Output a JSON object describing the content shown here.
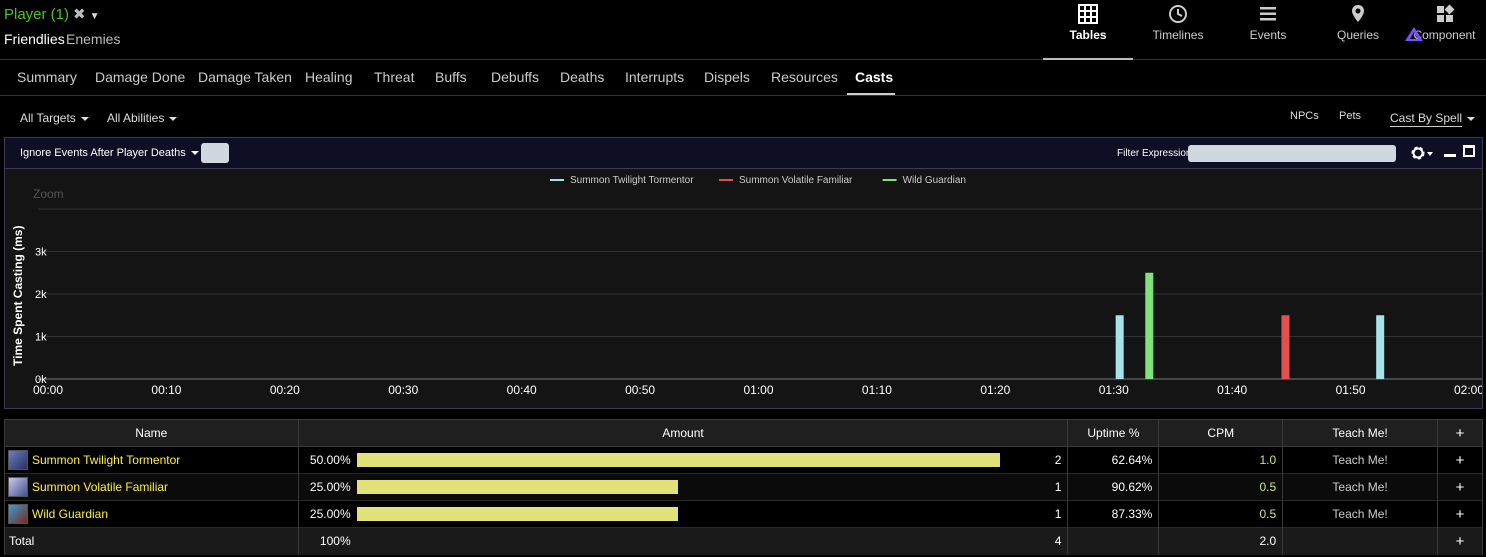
{
  "header": {
    "player_label": "Player (1)",
    "friendlies": "Friendlies",
    "enemies": "Enemies",
    "nav": [
      {
        "label": "Tables",
        "icon": "table-icon"
      },
      {
        "label": "Timelines",
        "icon": "clock-icon"
      },
      {
        "label": "Events",
        "icon": "list-icon"
      },
      {
        "label": "Queries",
        "icon": "map-pin-icon"
      },
      {
        "label": "Component",
        "icon": "components-icon"
      }
    ]
  },
  "tabs": [
    "Summary",
    "Damage Done",
    "Damage Taken",
    "Healing",
    "Threat",
    "Buffs",
    "Debuffs",
    "Deaths",
    "Interrupts",
    "Dispels",
    "Resources",
    "Casts"
  ],
  "active_tab": "Casts",
  "filters": {
    "targets": "All Targets",
    "abilities": "All Abilities",
    "npcs": "NPCs",
    "pets": "Pets",
    "cast_by": "Cast By Spell"
  },
  "graph_toolbar": {
    "ignore_label": "Ignore Events After Player Deaths",
    "filter_label": "Filter Expression:",
    "filter_value": ""
  },
  "chart_data": {
    "type": "bar",
    "ylabel": "Time Spent Casting (ms)",
    "zoom_label": "Zoom",
    "y_ticks": [
      "0k",
      "1k",
      "2k",
      "3k"
    ],
    "ylim": [
      0,
      3500
    ],
    "x_ticks": [
      "00:00",
      "00:10",
      "00:20",
      "00:30",
      "00:40",
      "00:50",
      "01:00",
      "01:10",
      "01:20",
      "01:30",
      "01:40",
      "01:50",
      "02:00"
    ],
    "xlim_seconds": [
      0,
      120
    ],
    "legend_position": "top-center",
    "series": [
      {
        "name": "Summon Twilight Tormentor",
        "color": "#a6e3e8",
        "points": [
          {
            "t": 90.5,
            "v": 1500
          },
          {
            "t": 112.5,
            "v": 1500
          }
        ]
      },
      {
        "name": "Summon Volatile Familiar",
        "color": "#e05050",
        "points": [
          {
            "t": 104.5,
            "v": 1500
          }
        ]
      },
      {
        "name": "Wild Guardian",
        "color": "#7ee37a",
        "points": [
          {
            "t": 93,
            "v": 2500
          }
        ]
      }
    ]
  },
  "table": {
    "headers": [
      "Name",
      "Amount",
      "Uptime %",
      "CPM",
      "Teach Me!",
      "+"
    ],
    "rows": [
      {
        "name": "Summon Twilight Tormentor",
        "pct": "50.00%",
        "bar": 1.0,
        "count": "2",
        "uptime": "62.64%",
        "cpm": "1.0",
        "teach": "Teach Me!",
        "plus": "+",
        "icon": "tormentor-icon"
      },
      {
        "name": "Summon Volatile Familiar",
        "pct": "25.00%",
        "bar": 0.5,
        "count": "1",
        "uptime": "90.62%",
        "cpm": "0.5",
        "teach": "Teach Me!",
        "plus": "+",
        "icon": "familiar-icon"
      },
      {
        "name": "Wild Guardian",
        "pct": "25.00%",
        "bar": 0.5,
        "count": "1",
        "uptime": "87.33%",
        "cpm": "0.5",
        "teach": "Teach Me!",
        "plus": "+",
        "icon": "guardian-icon"
      }
    ],
    "total": {
      "label": "Total",
      "pct": "100%",
      "count": "4",
      "cpm": "2.0",
      "plus": "+"
    }
  }
}
